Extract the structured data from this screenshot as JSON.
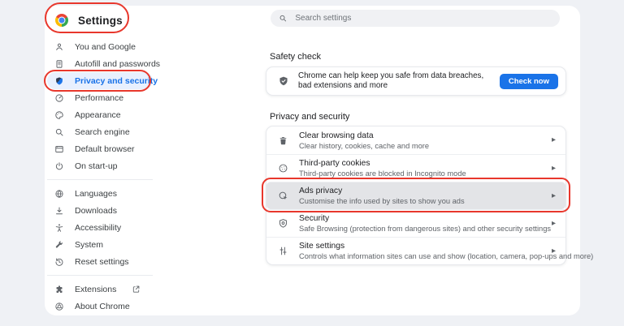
{
  "colors": {
    "accent": "#1a73e8",
    "annotation_red": "#e8372c",
    "selected_item_bg": "#e8f0fe",
    "highlighted_row_bg": "#e3e4e7"
  },
  "header": {
    "title": "Settings"
  },
  "search": {
    "placeholder": "Search settings"
  },
  "sidebar": {
    "groups": [
      {
        "items": [
          {
            "label": "You and Google",
            "icon": "person-icon"
          },
          {
            "label": "Autofill and passwords",
            "icon": "autofill-icon"
          },
          {
            "label": "Privacy and security",
            "icon": "privacy-shield-icon",
            "selected": true,
            "annotated": true
          },
          {
            "label": "Performance",
            "icon": "speedometer-icon"
          },
          {
            "label": "Appearance",
            "icon": "palette-icon"
          },
          {
            "label": "Search engine",
            "icon": "search-icon"
          },
          {
            "label": "Default browser",
            "icon": "browser-window-icon"
          },
          {
            "label": "On start-up",
            "icon": "power-icon"
          }
        ]
      },
      {
        "items": [
          {
            "label": "Languages",
            "icon": "globe-icon"
          },
          {
            "label": "Downloads",
            "icon": "download-icon"
          },
          {
            "label": "Accessibility",
            "icon": "accessibility-icon"
          },
          {
            "label": "System",
            "icon": "wrench-icon"
          },
          {
            "label": "Reset settings",
            "icon": "reset-icon"
          }
        ]
      },
      {
        "items": [
          {
            "label": "Extensions",
            "icon": "puzzle-icon",
            "trailing_icon": "external-link-icon"
          },
          {
            "label": "About Chrome",
            "icon": "chrome-outline-icon"
          }
        ]
      }
    ]
  },
  "safety_check": {
    "heading": "Safety check",
    "message": "Chrome can help keep you safe from data breaches, bad extensions and more",
    "button_label": "Check now",
    "icon": "shield-check-icon"
  },
  "privacy_section": {
    "heading": "Privacy and security",
    "rows": [
      {
        "title": "Clear browsing data",
        "subtitle": "Clear history, cookies, cache and more",
        "icon": "trash-icon"
      },
      {
        "title": "Third-party cookies",
        "subtitle": "Third-party cookies are blocked in Incognito mode",
        "icon": "cookie-icon"
      },
      {
        "title": "Ads privacy",
        "subtitle": "Customise the info used by sites to show you ads",
        "icon": "ads-click-icon",
        "highlighted": true,
        "annotated": true
      },
      {
        "title": "Security",
        "subtitle": "Safe Browsing (protection from dangerous sites) and other security settings",
        "icon": "security-shield-icon"
      },
      {
        "title": "Site settings",
        "subtitle": "Controls what information sites can use and show (location, camera, pop-ups and more)",
        "icon": "tune-icon"
      }
    ]
  },
  "icons": {
    "chevron": "▸"
  }
}
